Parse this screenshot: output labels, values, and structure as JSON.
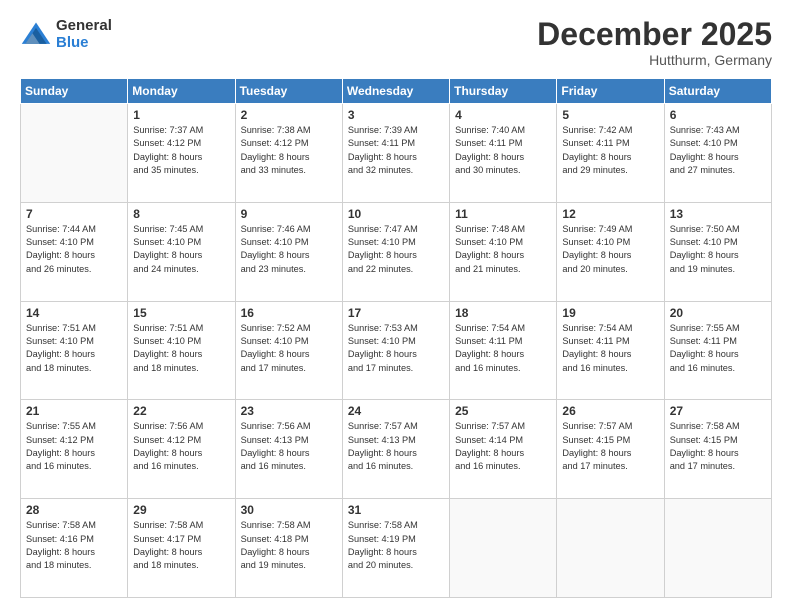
{
  "logo": {
    "general": "General",
    "blue": "Blue"
  },
  "header": {
    "month": "December 2025",
    "location": "Hutthurm, Germany"
  },
  "weekdays": [
    "Sunday",
    "Monday",
    "Tuesday",
    "Wednesday",
    "Thursday",
    "Friday",
    "Saturday"
  ],
  "weeks": [
    [
      {
        "day": "",
        "info": ""
      },
      {
        "day": "1",
        "info": "Sunrise: 7:37 AM\nSunset: 4:12 PM\nDaylight: 8 hours\nand 35 minutes."
      },
      {
        "day": "2",
        "info": "Sunrise: 7:38 AM\nSunset: 4:12 PM\nDaylight: 8 hours\nand 33 minutes."
      },
      {
        "day": "3",
        "info": "Sunrise: 7:39 AM\nSunset: 4:11 PM\nDaylight: 8 hours\nand 32 minutes."
      },
      {
        "day": "4",
        "info": "Sunrise: 7:40 AM\nSunset: 4:11 PM\nDaylight: 8 hours\nand 30 minutes."
      },
      {
        "day": "5",
        "info": "Sunrise: 7:42 AM\nSunset: 4:11 PM\nDaylight: 8 hours\nand 29 minutes."
      },
      {
        "day": "6",
        "info": "Sunrise: 7:43 AM\nSunset: 4:10 PM\nDaylight: 8 hours\nand 27 minutes."
      }
    ],
    [
      {
        "day": "7",
        "info": "Sunrise: 7:44 AM\nSunset: 4:10 PM\nDaylight: 8 hours\nand 26 minutes."
      },
      {
        "day": "8",
        "info": "Sunrise: 7:45 AM\nSunset: 4:10 PM\nDaylight: 8 hours\nand 24 minutes."
      },
      {
        "day": "9",
        "info": "Sunrise: 7:46 AM\nSunset: 4:10 PM\nDaylight: 8 hours\nand 23 minutes."
      },
      {
        "day": "10",
        "info": "Sunrise: 7:47 AM\nSunset: 4:10 PM\nDaylight: 8 hours\nand 22 minutes."
      },
      {
        "day": "11",
        "info": "Sunrise: 7:48 AM\nSunset: 4:10 PM\nDaylight: 8 hours\nand 21 minutes."
      },
      {
        "day": "12",
        "info": "Sunrise: 7:49 AM\nSunset: 4:10 PM\nDaylight: 8 hours\nand 20 minutes."
      },
      {
        "day": "13",
        "info": "Sunrise: 7:50 AM\nSunset: 4:10 PM\nDaylight: 8 hours\nand 19 minutes."
      }
    ],
    [
      {
        "day": "14",
        "info": "Sunrise: 7:51 AM\nSunset: 4:10 PM\nDaylight: 8 hours\nand 18 minutes."
      },
      {
        "day": "15",
        "info": "Sunrise: 7:51 AM\nSunset: 4:10 PM\nDaylight: 8 hours\nand 18 minutes."
      },
      {
        "day": "16",
        "info": "Sunrise: 7:52 AM\nSunset: 4:10 PM\nDaylight: 8 hours\nand 17 minutes."
      },
      {
        "day": "17",
        "info": "Sunrise: 7:53 AM\nSunset: 4:10 PM\nDaylight: 8 hours\nand 17 minutes."
      },
      {
        "day": "18",
        "info": "Sunrise: 7:54 AM\nSunset: 4:11 PM\nDaylight: 8 hours\nand 16 minutes."
      },
      {
        "day": "19",
        "info": "Sunrise: 7:54 AM\nSunset: 4:11 PM\nDaylight: 8 hours\nand 16 minutes."
      },
      {
        "day": "20",
        "info": "Sunrise: 7:55 AM\nSunset: 4:11 PM\nDaylight: 8 hours\nand 16 minutes."
      }
    ],
    [
      {
        "day": "21",
        "info": "Sunrise: 7:55 AM\nSunset: 4:12 PM\nDaylight: 8 hours\nand 16 minutes."
      },
      {
        "day": "22",
        "info": "Sunrise: 7:56 AM\nSunset: 4:12 PM\nDaylight: 8 hours\nand 16 minutes."
      },
      {
        "day": "23",
        "info": "Sunrise: 7:56 AM\nSunset: 4:13 PM\nDaylight: 8 hours\nand 16 minutes."
      },
      {
        "day": "24",
        "info": "Sunrise: 7:57 AM\nSunset: 4:13 PM\nDaylight: 8 hours\nand 16 minutes."
      },
      {
        "day": "25",
        "info": "Sunrise: 7:57 AM\nSunset: 4:14 PM\nDaylight: 8 hours\nand 16 minutes."
      },
      {
        "day": "26",
        "info": "Sunrise: 7:57 AM\nSunset: 4:15 PM\nDaylight: 8 hours\nand 17 minutes."
      },
      {
        "day": "27",
        "info": "Sunrise: 7:58 AM\nSunset: 4:15 PM\nDaylight: 8 hours\nand 17 minutes."
      }
    ],
    [
      {
        "day": "28",
        "info": "Sunrise: 7:58 AM\nSunset: 4:16 PM\nDaylight: 8 hours\nand 18 minutes."
      },
      {
        "day": "29",
        "info": "Sunrise: 7:58 AM\nSunset: 4:17 PM\nDaylight: 8 hours\nand 18 minutes."
      },
      {
        "day": "30",
        "info": "Sunrise: 7:58 AM\nSunset: 4:18 PM\nDaylight: 8 hours\nand 19 minutes."
      },
      {
        "day": "31",
        "info": "Sunrise: 7:58 AM\nSunset: 4:19 PM\nDaylight: 8 hours\nand 20 minutes."
      },
      {
        "day": "",
        "info": ""
      },
      {
        "day": "",
        "info": ""
      },
      {
        "day": "",
        "info": ""
      }
    ]
  ]
}
